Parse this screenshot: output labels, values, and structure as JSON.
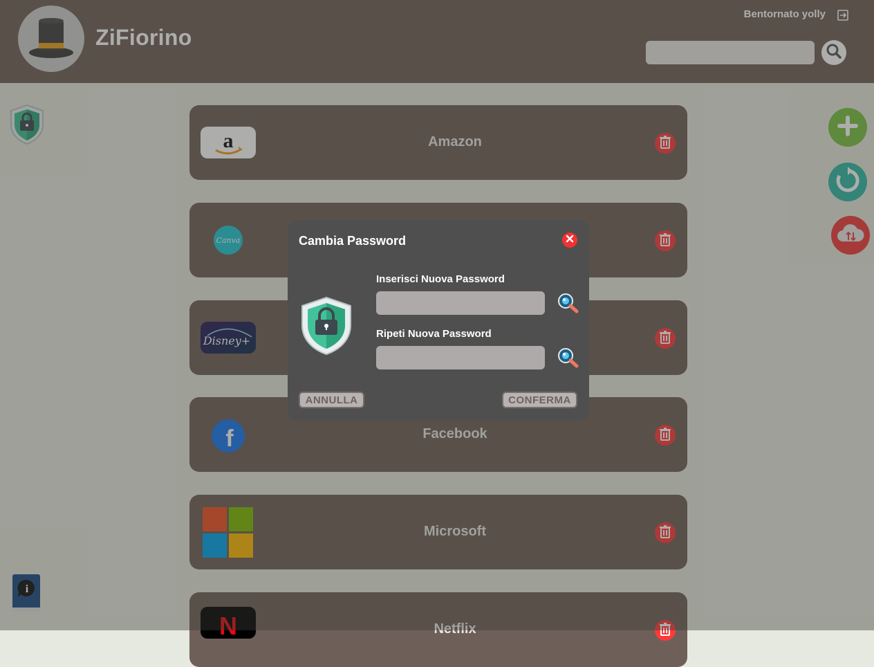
{
  "header": {
    "brand": "ZiFiorino",
    "welcome": "Bentornato yolly",
    "search_placeholder": ""
  },
  "cards": [
    {
      "name": "Amazon",
      "logo": "amazon-logo"
    },
    {
      "name": "Canva",
      "logo": "canva-logo"
    },
    {
      "name": "Disney+",
      "logo": "disney-plus-logo"
    },
    {
      "name": "Facebook",
      "logo": "facebook-logo"
    },
    {
      "name": "Microsoft",
      "logo": "microsoft-logo"
    },
    {
      "name": "Netflix",
      "logo": "netflix-logo"
    }
  ],
  "modal": {
    "title": "Cambia Password",
    "new_password_label": "Inserisci Nuova Password",
    "repeat_password_label": "Ripeti Nuova Password",
    "cancel_label": "ANNULLA",
    "confirm_label": "CONFERMA"
  },
  "colors": {
    "header_bg": "#6e6059",
    "card_bg": "#6e6059",
    "page_bg": "#e6e9df",
    "modal_bg": "#4f4f4f",
    "delete_red": "#ff3a3a",
    "add_green": "#79c143",
    "refresh_teal": "#2fb8a6",
    "cloud_red": "#f23c3c"
  },
  "icons": [
    "hat-avatar-icon",
    "logout-icon",
    "search-icon",
    "shield-lock-icon",
    "info-book-icon",
    "add-icon",
    "refresh-icon",
    "cloud-sync-icon",
    "trash-icon",
    "close-icon",
    "eye-magnifier-icon"
  ]
}
